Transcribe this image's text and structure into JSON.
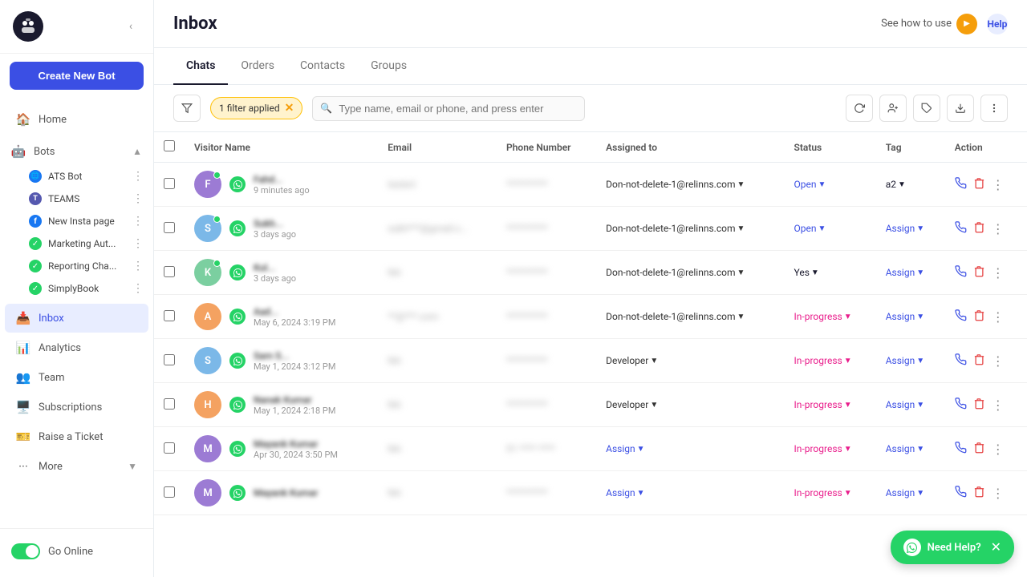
{
  "sidebar": {
    "logo": "🤖",
    "collapse_label": "‹",
    "create_bot_label": "Create New Bot",
    "nav_items": [
      {
        "id": "home",
        "label": "Home",
        "icon": "🏠"
      },
      {
        "id": "bots",
        "label": "Bots",
        "icon": "🤖",
        "has_toggle": true
      }
    ],
    "bots": [
      {
        "id": "ats-bot",
        "label": "ATS Bot",
        "badge_type": "blue",
        "badge_text": "🌐"
      },
      {
        "id": "teams",
        "label": "TEAMS",
        "badge_type": "teams",
        "badge_text": "T"
      },
      {
        "id": "new-insta",
        "label": "New Insta page",
        "badge_type": "fb",
        "badge_text": "f"
      },
      {
        "id": "marketing",
        "label": "Marketing Aut...",
        "badge_type": "wa",
        "badge_text": "✓"
      },
      {
        "id": "reporting",
        "label": "Reporting Cha...",
        "badge_type": "wa",
        "badge_text": "✓"
      },
      {
        "id": "simplybook",
        "label": "SimplyBook",
        "badge_type": "wa",
        "badge_text": "✓"
      }
    ],
    "nav_items2": [
      {
        "id": "inbox",
        "label": "Inbox",
        "icon": "📥",
        "active": true
      },
      {
        "id": "analytics",
        "label": "Analytics",
        "icon": "📊"
      },
      {
        "id": "team",
        "label": "Team",
        "icon": "👥"
      },
      {
        "id": "subscriptions",
        "label": "Subscriptions",
        "icon": "🖥️"
      },
      {
        "id": "raise-ticket",
        "label": "Raise a Ticket",
        "icon": "🎫"
      },
      {
        "id": "more",
        "label": "More",
        "icon": "···"
      }
    ],
    "go_online_label": "Go Online"
  },
  "header": {
    "title": "Inbox",
    "see_how_label": "See how to use",
    "help_label": "Help",
    "play_icon": "▶",
    "question_icon": "?"
  },
  "tabs": [
    {
      "id": "chats",
      "label": "Chats",
      "active": true
    },
    {
      "id": "orders",
      "label": "Orders",
      "active": false
    },
    {
      "id": "contacts",
      "label": "Contacts",
      "active": false
    },
    {
      "id": "groups",
      "label": "Groups",
      "active": false
    }
  ],
  "toolbar": {
    "filter_label": "1 filter applied",
    "search_placeholder": "Type name, email or phone, and press enter"
  },
  "table": {
    "columns": [
      {
        "id": "visitor",
        "label": "Visitor Name"
      },
      {
        "id": "email",
        "label": "Email"
      },
      {
        "id": "phone",
        "label": "Phone Number"
      },
      {
        "id": "assigned",
        "label": "Assigned to"
      },
      {
        "id": "status",
        "label": "Status"
      },
      {
        "id": "tag",
        "label": "Tag"
      },
      {
        "id": "action",
        "label": "Action"
      }
    ],
    "rows": [
      {
        "id": "row1",
        "avatar_letter": "F",
        "avatar_color": "#9c7bd4",
        "visitor_name": "Fahd...",
        "time": "9 minutes ago",
        "email": "testert",
        "phone": "**********",
        "assigned_to": "Don-not-delete-1@relinns.com",
        "status": "Open",
        "status_type": "open",
        "tag": "a2",
        "tag_type": "tag"
      },
      {
        "id": "row2",
        "avatar_letter": "S",
        "avatar_color": "#7bb8e8",
        "visitor_name": "Sukh...",
        "time": "3 days ago",
        "email": "sukh***@gmail.c...",
        "phone": "**********",
        "assigned_to": "Don-not-delete-1@relinns.com",
        "status": "Open",
        "status_type": "open",
        "tag": "Assign",
        "tag_type": "assign"
      },
      {
        "id": "row3",
        "avatar_letter": "K",
        "avatar_color": "#7bcfa0",
        "visitor_name": "Kul...",
        "time": "3 days ago",
        "email": "NA",
        "phone": "**********",
        "assigned_to": "Don-not-delete-1@relinns.com",
        "status": "Yes",
        "status_type": "yes",
        "tag": "Assign",
        "tag_type": "assign"
      },
      {
        "id": "row4",
        "avatar_letter": "A",
        "avatar_color": "#f4a261",
        "visitor_name": "Aad...",
        "time": "May 6, 2024 3:19 PM",
        "email": "**@***.com",
        "phone": "**********",
        "assigned_to": "Don-not-delete-1@relinns.com",
        "status": "In-progress",
        "status_type": "inprogress",
        "tag": "Assign",
        "tag_type": "assign"
      },
      {
        "id": "row5",
        "avatar_letter": "S",
        "avatar_color": "#7bb8e8",
        "visitor_name": "Sam S...",
        "time": "May 1, 2024 3:12 PM",
        "email": "NA",
        "phone": "**********",
        "assigned_to": "Developer",
        "status": "In-progress",
        "status_type": "inprogress",
        "tag": "Assign",
        "tag_type": "assign"
      },
      {
        "id": "row6",
        "avatar_letter": "H",
        "avatar_color": "#f4a261",
        "visitor_name": "Nanak Kumar",
        "time": "May 1, 2024 2:18 PM",
        "email": "NA",
        "phone": "**********",
        "assigned_to": "Developer",
        "status": "In-progress",
        "status_type": "inprogress",
        "tag": "Assign",
        "tag_type": "assign"
      },
      {
        "id": "row7",
        "avatar_letter": "M",
        "avatar_color": "#9c7bd4",
        "visitor_name": "Mayank Kumar",
        "time": "Apr 30, 2024 3:50 PM",
        "email": "NA",
        "phone": "91 **** ****",
        "assigned_to": "Assign",
        "assigned_type": "assign",
        "status": "In-progress",
        "status_type": "inprogress",
        "tag": "Assign",
        "tag_type": "assign"
      },
      {
        "id": "row8",
        "avatar_letter": "M",
        "avatar_color": "#9c7bd4",
        "visitor_name": "Mayank Kumar",
        "time": "",
        "email": "NA",
        "phone": "**********",
        "assigned_to": "Assign",
        "assigned_type": "assign",
        "status": "In-progress",
        "status_type": "inprogress",
        "tag": "Assign",
        "tag_type": "assign"
      }
    ]
  },
  "need_help": {
    "label": "Need Help?",
    "close_icon": "✕"
  }
}
